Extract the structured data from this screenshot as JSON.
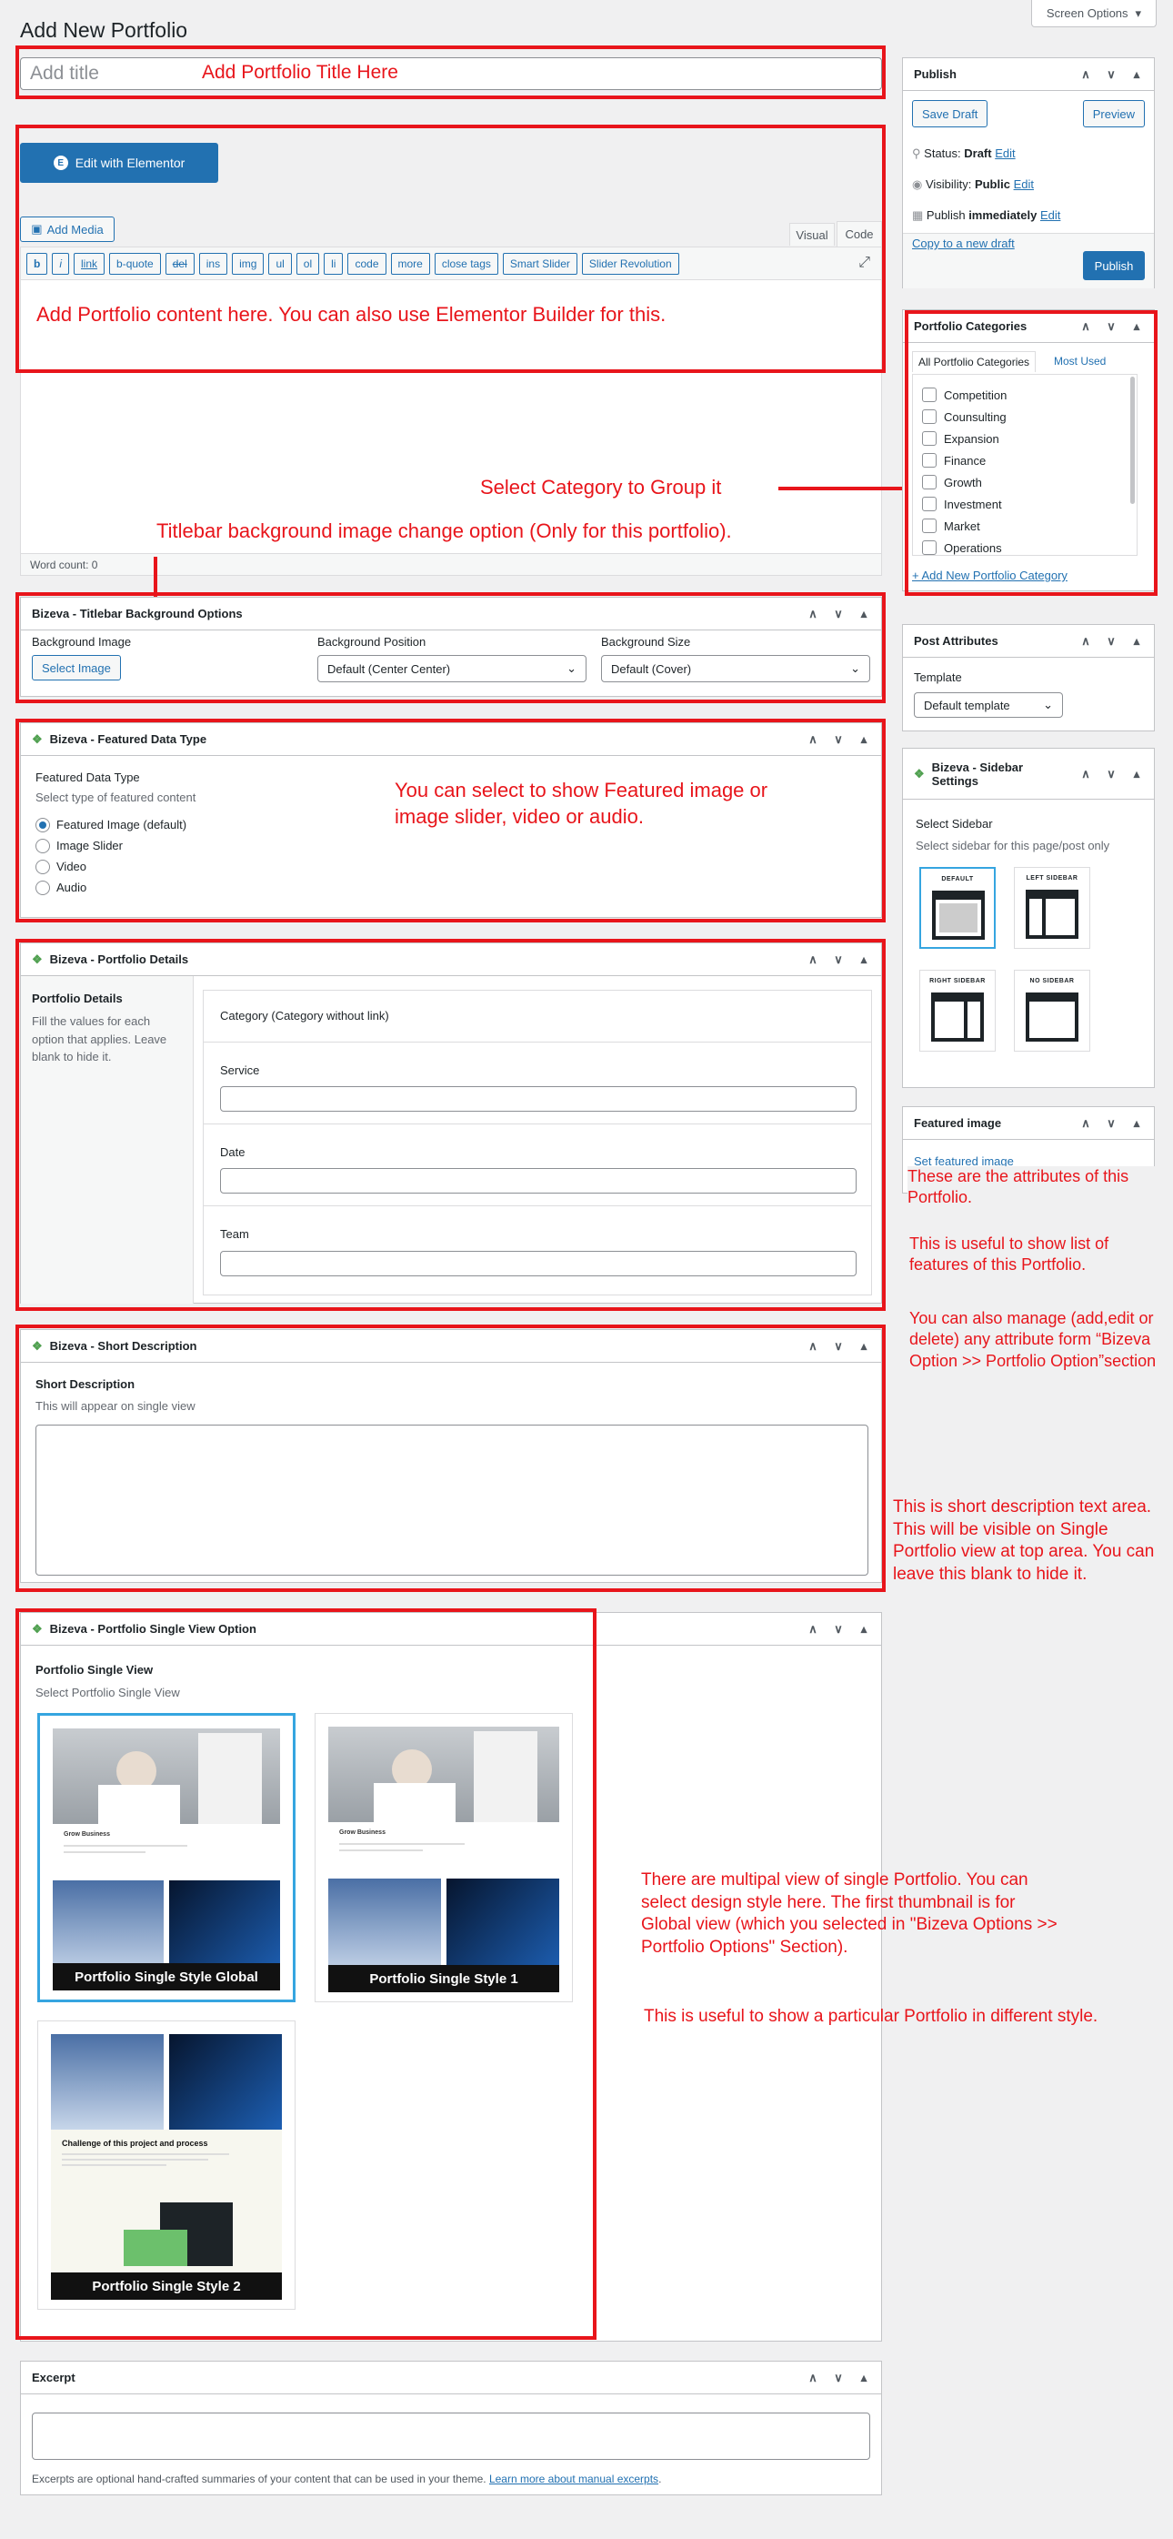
{
  "page": {
    "title": "Add New Portfolio",
    "screen_options": "Screen Options"
  },
  "title_box": {
    "placeholder": "Add title",
    "annotation": "Add Portfolio Title Here"
  },
  "editor": {
    "elementor_button": "Edit with Elementor",
    "add_media": "Add Media",
    "tab_visual": "Visual",
    "tab_code": "Code",
    "quicktags": [
      "b",
      "i",
      "link",
      "b-quote",
      "del",
      "ins",
      "img",
      "ul",
      "ol",
      "li",
      "code",
      "more",
      "close tags",
      "Smart Slider",
      "Slider Revolution"
    ],
    "annotation": "Add Portfolio content here. You can also use Elementor Builder for this.",
    "word_count": "Word count: 0"
  },
  "notes": {
    "category": "Select Category to Group it",
    "titlebar": "Titlebar background image change option (Only for this portfolio).",
    "featured_type": "You can select to show Featured image or image slider, video or audio.",
    "attributes_1": "These are the attributes of this Portfolio.",
    "attributes_2": "This is useful to show list of features of this Portfolio.",
    "attributes_3": "You can also manage (add,edit or delete) any attribute form “Bizeva Option >> Portfolio Option”section",
    "short_desc": "This is short description text area. This will be visible on Single Portfolio view at top area. You can leave this blank to hide it.",
    "single_view_1": "There are multipal view of single Portfolio. You can select design style here. The first thumbnail is for Global view (which you selected in \"Bizeva Options >> Portfolio Options\" Section).",
    "single_view_2": "This is useful to show a particular Portfolio in different style."
  },
  "titlebar": {
    "heading": "Bizeva - Titlebar Background Options",
    "bg_image_label": "Background Image",
    "select_image": "Select Image",
    "bg_position_label": "Background Position",
    "bg_position_value": "Default (Center Center)",
    "bg_size_label": "Background Size",
    "bg_size_value": "Default (Cover)"
  },
  "featured_type": {
    "heading": "Bizeva - Featured Data Type",
    "label": "Featured Data Type",
    "desc": "Select type of featured content",
    "options": [
      "Featured Image (default)",
      "Image Slider",
      "Video",
      "Audio"
    ]
  },
  "details": {
    "heading": "Bizeva - Portfolio Details",
    "side_label": "Portfolio Details",
    "side_desc": "Fill the values for each option that applies. Leave blank to hide it.",
    "category_label": "Category (Category without link)",
    "service_label": "Service",
    "date_label": "Date",
    "team_label": "Team"
  },
  "short_desc": {
    "heading": "Bizeva - Short Description",
    "label": "Short Description",
    "desc": "This will appear on single view"
  },
  "single_view": {
    "heading": "Bizeva - Portfolio Single View Option",
    "label": "Portfolio Single View",
    "desc": "Select Portfolio Single View",
    "thumbs": [
      "Portfolio Single Style Global",
      "Portfolio Single Style 1",
      "Portfolio Single Style 2"
    ],
    "mock_business": "Grow Business",
    "mock_challenge": "Challenge of this project and process"
  },
  "excerpt": {
    "heading": "Excerpt",
    "desc": "Excerpts are optional hand-crafted summaries of your content that can be used in your theme.",
    "link": "Learn more about manual excerpts"
  },
  "publish": {
    "heading": "Publish",
    "save_draft": "Save Draft",
    "preview": "Preview",
    "status_label": "Status:",
    "status_value": "Draft",
    "visibility_label": "Visibility:",
    "visibility_value": "Public",
    "publish_label": "Publish",
    "publish_value": "immediately",
    "edit": "Edit",
    "copy_draft": "Copy to a new draft",
    "publish_button": "Publish"
  },
  "categories": {
    "heading": "Portfolio Categories",
    "tab_all": "All Portfolio Categories",
    "tab_used": "Most Used",
    "items": [
      "Competition",
      "Counsulting",
      "Expansion",
      "Finance",
      "Growth",
      "Investment",
      "Market",
      "Operations"
    ],
    "add_new": "+ Add New Portfolio Category"
  },
  "attributes": {
    "heading": "Post Attributes",
    "template_label": "Template",
    "template_value": "Default template"
  },
  "sidebar": {
    "heading": "Bizeva - Sidebar Settings",
    "label": "Select Sidebar",
    "desc": "Select sidebar for this page/post only",
    "layouts": [
      "DEFAULT",
      "LEFT SIDEBAR",
      "RIGHT SIDEBAR",
      "NO SIDEBAR"
    ]
  },
  "featured_image": {
    "heading": "Featured image",
    "link": "Set featured image"
  },
  "colors": {
    "annotation_red": "#e8151b",
    "wp_blue": "#2271b1",
    "selected_border": "#35a5e0"
  }
}
